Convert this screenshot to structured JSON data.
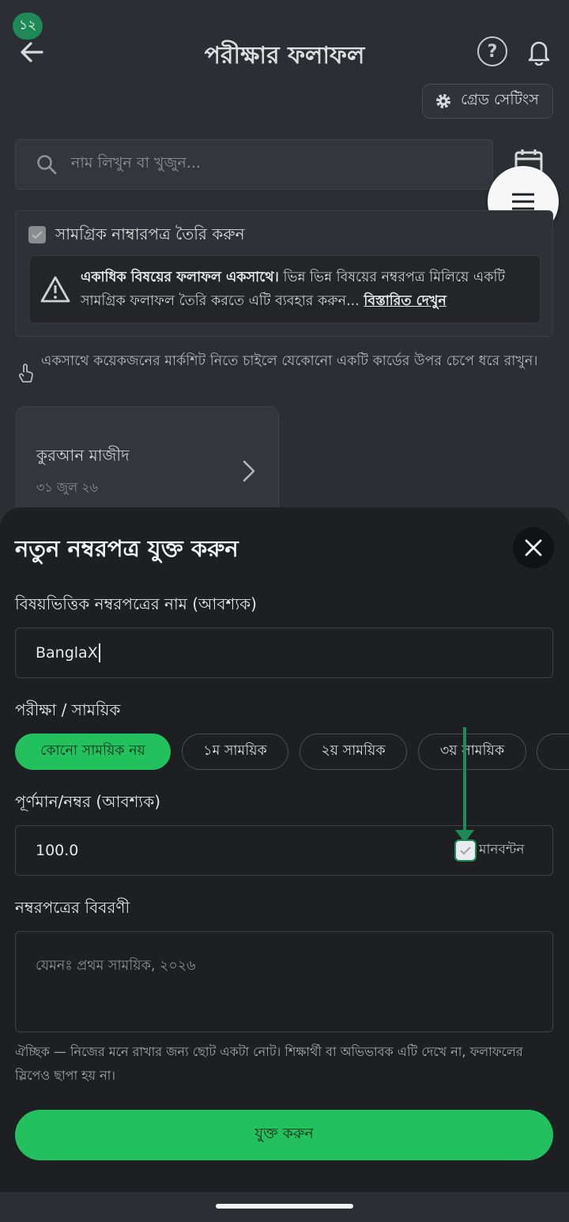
{
  "status": {
    "badge": "১২"
  },
  "header": {
    "title": "পরীক্ষার ফলাফল"
  },
  "grade_settings": {
    "label": "গ্রেড সেটিংস"
  },
  "search": {
    "placeholder": "নাম লিখুন বা খুজুন..."
  },
  "combined": {
    "label": "সামগ্রিক নাম্বারপত্র তৈরি করুন",
    "warning_bold": "একাধিক বিষয়ের ফলাফল একসাথে।",
    "warning_text": " ভিন্ন ভিন্ন বিষয়ের নম্বরপত্র মিলিয়ে একটি সামগ্রিক ফলাফল তৈরি করতে এটি ব্যবহার করুন... ",
    "warning_link": "বিস্তারিত দেখুন"
  },
  "hint": {
    "text": "একসাথে কয়েকজনের মার্কশিট নিতে চাইলে যেকোনো একটি কার্ডের উপর চেপে ধরে রাখুন।"
  },
  "subject_card": {
    "name": "কুরআন মাজীদ",
    "date": "৩১ জুল ২৬"
  },
  "sheet": {
    "title": "নতুন নম্বরপত্র যুক্ত করুন",
    "name_label": "বিষয়ভিত্তিক নম্বরপত্রের নাম (আবশ্যক)",
    "name_value": "BanglaX",
    "exam_label": "পরীক্ষা / সাময়িক",
    "chips": [
      "কোনো সাময়িক নয়",
      "১ম সাময়িক",
      "২য় সাময়িক",
      "৩য় সাময়িক"
    ],
    "marks_label": "পূর্ণমান/নম্বর (আবশ্যক)",
    "marks_value": "100.0",
    "distribution_label": "মানবন্টন",
    "desc_label": "নম্বরপত্রের বিবরণী",
    "desc_placeholder": "যেমনঃ প্রথম সাময়িক, ২০২৬",
    "desc_help": "ঐচ্ছিক — নিজের মনে রাখার জন্য ছোট একটা নোট। শিক্ষার্থী বা অভিভাবক এটি দেখে না, ফলাফলের স্লিপেও ছাপা হয় না।",
    "submit_label": "যুক্ত করুন"
  },
  "colors": {
    "accent": "#22c15e",
    "sheet_bg": "#1d1f22",
    "page_bg": "#2b2e32",
    "marker": "#1f8a57"
  },
  "icons": [
    "back-arrow-icon",
    "help-icon",
    "bell-icon",
    "gear-icon",
    "search-icon",
    "calendar-icon",
    "menu-icon",
    "checkbox-icon",
    "warning-icon",
    "touch-hold-icon",
    "chevron-right-icon",
    "close-icon"
  ]
}
